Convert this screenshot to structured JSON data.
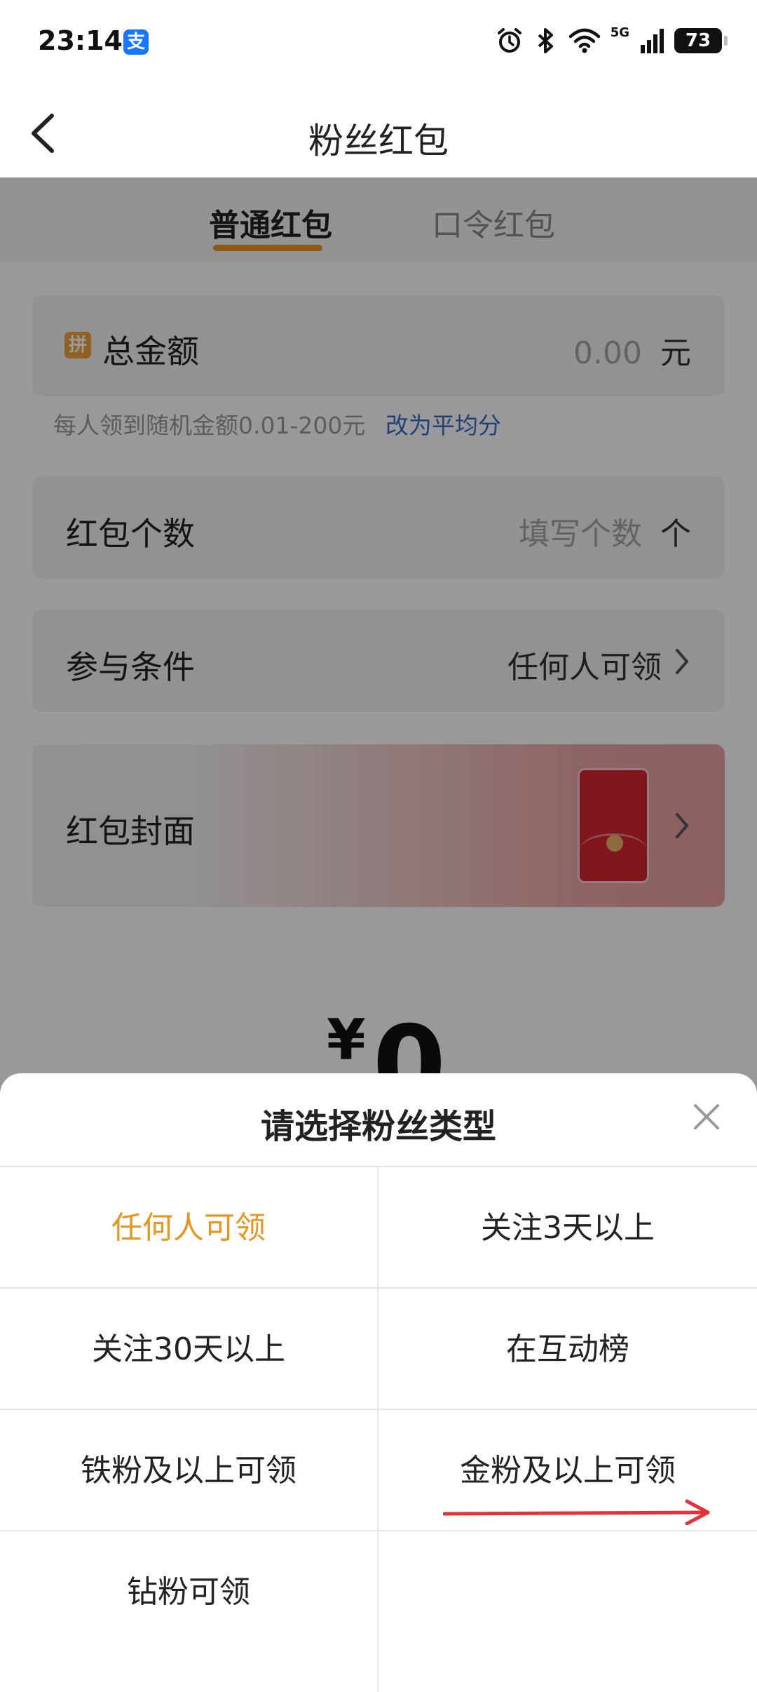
{
  "status_bar": {
    "time": "23:14",
    "app_badge": "支",
    "network": "5G",
    "battery": "73",
    "icons": [
      "alarm-icon",
      "bluetooth-icon",
      "wifi-icon",
      "signal-icon",
      "battery-icon"
    ]
  },
  "header": {
    "title": "粉丝红包"
  },
  "tabs": [
    {
      "label": "普通红包",
      "active": true
    },
    {
      "label": "口令红包",
      "active": false
    }
  ],
  "form": {
    "total_amount": {
      "label": "总金额",
      "badge": "拼",
      "value": "0.00",
      "unit": "元"
    },
    "hint": {
      "text": "每人领到随机金额0.01-200元",
      "link": "改为平均分"
    },
    "packet_count": {
      "label": "红包个数",
      "placeholder": "填写个数",
      "unit": "个"
    },
    "condition": {
      "label": "参与条件",
      "value": "任何人可领"
    },
    "cover": {
      "label": "红包封面"
    },
    "amount_display": {
      "currency": "¥",
      "value": "0"
    }
  },
  "sheet": {
    "title": "请选择粉丝类型",
    "options": [
      {
        "label": "任何人可领",
        "selected": true
      },
      {
        "label": "关注3天以上",
        "selected": false
      },
      {
        "label": "关注30天以上",
        "selected": false
      },
      {
        "label": "在互动榜",
        "selected": false
      },
      {
        "label": "铁粉及以上可领",
        "selected": false
      },
      {
        "label": "金粉及以上可领",
        "selected": false
      },
      {
        "label": "钻粉可领",
        "selected": false
      }
    ]
  },
  "colors": {
    "accent": "#e9961f",
    "link": "#3a6fc7",
    "annotation_arrow": "#e2333a"
  }
}
